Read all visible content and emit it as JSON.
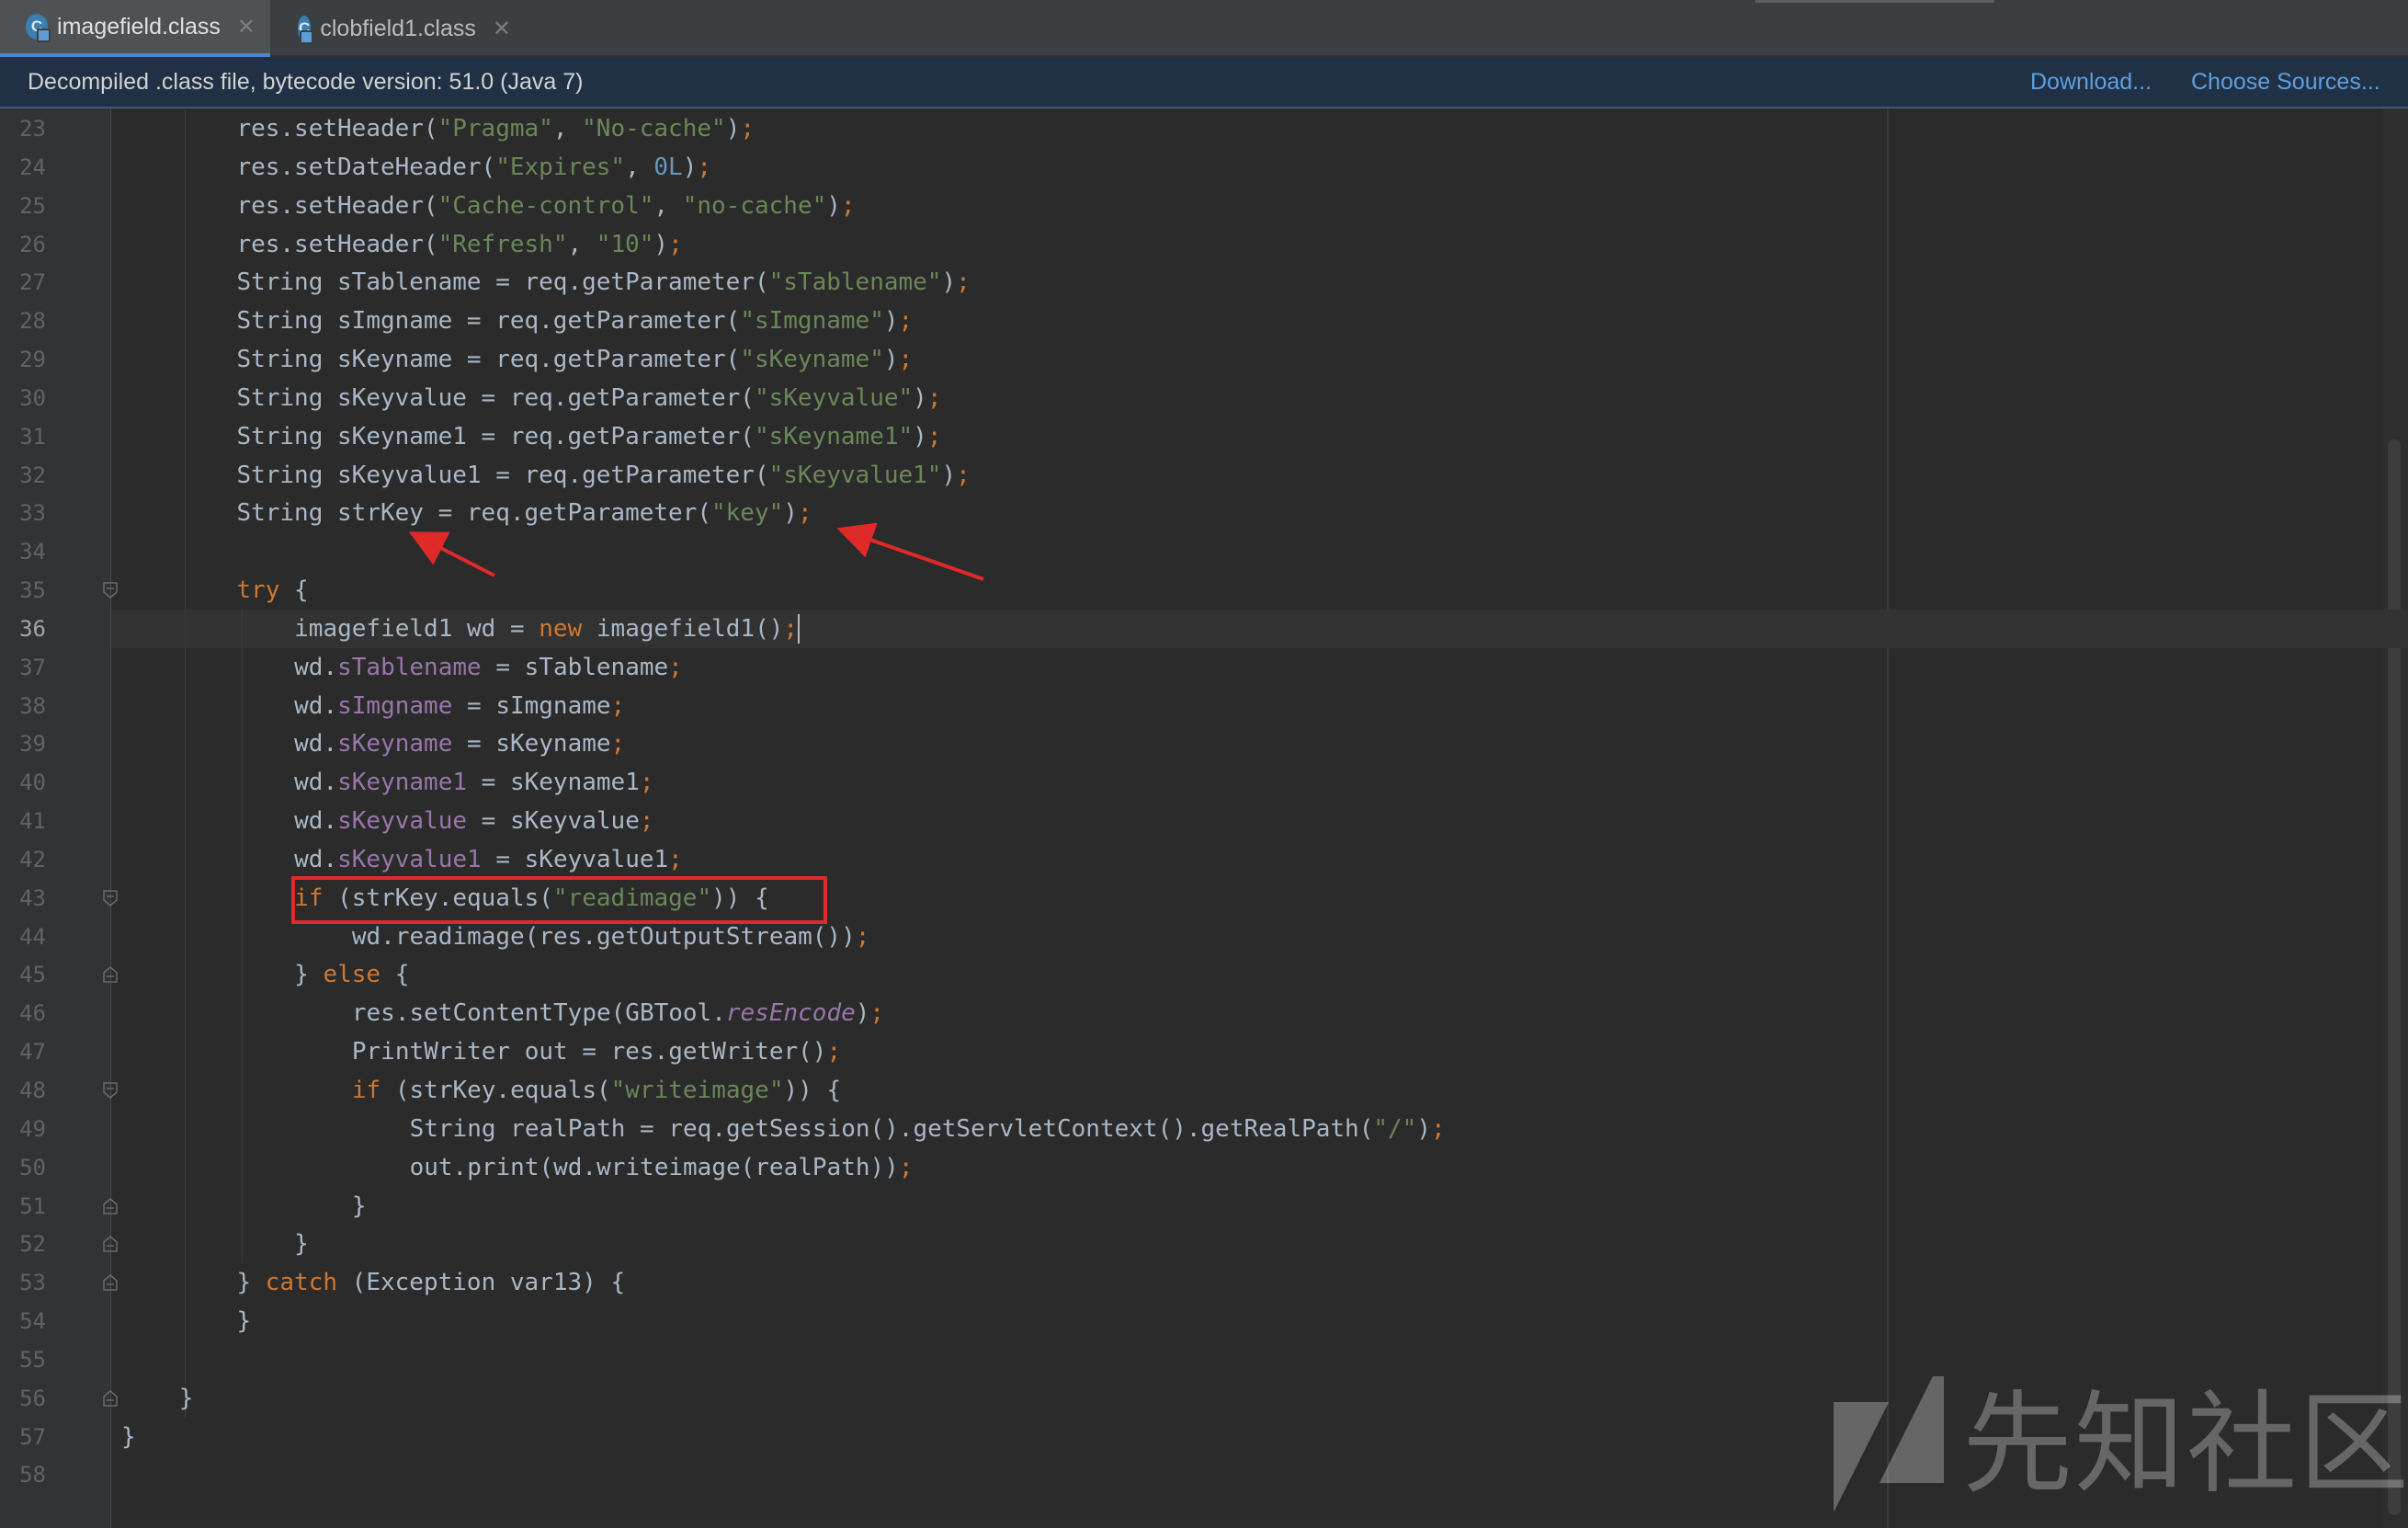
{
  "tabs": [
    {
      "label": "imagefield.class",
      "icon": "class-file-icon",
      "active": true
    },
    {
      "label": "clobfield1.class",
      "icon": "class-file-icon",
      "active": false
    }
  ],
  "banner": {
    "message": "Decompiled .class file, bytecode version: 51.0 (Java 7)",
    "download_label": "Download...",
    "choose_sources_label": "Choose Sources..."
  },
  "editor": {
    "current_line": 36,
    "line_numbers": [
      "23",
      "24",
      "25",
      "26",
      "27",
      "28",
      "29",
      "30",
      "31",
      "32",
      "33",
      "34",
      "35",
      "36",
      "37",
      "38",
      "39",
      "40",
      "41",
      "42",
      "43",
      "44",
      "45",
      "46",
      "47",
      "48",
      "49",
      "50",
      "51",
      "52",
      "53",
      "54",
      "55",
      "56",
      "57",
      "58"
    ]
  },
  "code_lines": [
    {
      "n": "23",
      "indent": 2,
      "tokens": [
        [
          "t",
          "res.setHeader("
        ],
        [
          "s",
          "\"Pragma\""
        ],
        [
          "t",
          ", "
        ],
        [
          "s",
          "\"No-cache\""
        ],
        [
          "t",
          ")"
        ],
        [
          "p",
          ";"
        ]
      ]
    },
    {
      "n": "24",
      "indent": 2,
      "tokens": [
        [
          "t",
          "res.setDateHeader("
        ],
        [
          "s",
          "\"Expires\""
        ],
        [
          "t",
          ", "
        ],
        [
          "n",
          "0L"
        ],
        [
          "t",
          ")"
        ],
        [
          "p",
          ";"
        ]
      ]
    },
    {
      "n": "25",
      "indent": 2,
      "tokens": [
        [
          "t",
          "res.setHeader("
        ],
        [
          "s",
          "\"Cache-control\""
        ],
        [
          "t",
          ", "
        ],
        [
          "s",
          "\"no-cache\""
        ],
        [
          "t",
          ")"
        ],
        [
          "p",
          ";"
        ]
      ]
    },
    {
      "n": "26",
      "indent": 2,
      "tokens": [
        [
          "t",
          "res.setHeader("
        ],
        [
          "s",
          "\"Refresh\""
        ],
        [
          "t",
          ", "
        ],
        [
          "s",
          "\"10\""
        ],
        [
          "t",
          ")"
        ],
        [
          "p",
          ";"
        ]
      ]
    },
    {
      "n": "27",
      "indent": 2,
      "tokens": [
        [
          "t",
          "String sTablename = req.getParameter("
        ],
        [
          "s",
          "\"sTablename\""
        ],
        [
          "t",
          ")"
        ],
        [
          "p",
          ";"
        ]
      ]
    },
    {
      "n": "28",
      "indent": 2,
      "tokens": [
        [
          "t",
          "String sImgname = req.getParameter("
        ],
        [
          "s",
          "\"sImgname\""
        ],
        [
          "t",
          ")"
        ],
        [
          "p",
          ";"
        ]
      ]
    },
    {
      "n": "29",
      "indent": 2,
      "tokens": [
        [
          "t",
          "String sKeyname = req.getParameter("
        ],
        [
          "s",
          "\"sKeyname\""
        ],
        [
          "t",
          ")"
        ],
        [
          "p",
          ";"
        ]
      ]
    },
    {
      "n": "30",
      "indent": 2,
      "tokens": [
        [
          "t",
          "String sKeyvalue = req.getParameter("
        ],
        [
          "s",
          "\"sKeyvalue\""
        ],
        [
          "t",
          ")"
        ],
        [
          "p",
          ";"
        ]
      ]
    },
    {
      "n": "31",
      "indent": 2,
      "tokens": [
        [
          "t",
          "String sKeyname1 = req.getParameter("
        ],
        [
          "s",
          "\"sKeyname1\""
        ],
        [
          "t",
          ")"
        ],
        [
          "p",
          ";"
        ]
      ]
    },
    {
      "n": "32",
      "indent": 2,
      "tokens": [
        [
          "t",
          "String sKeyvalue1 = req.getParameter("
        ],
        [
          "s",
          "\"sKeyvalue1\""
        ],
        [
          "t",
          ")"
        ],
        [
          "p",
          ";"
        ]
      ]
    },
    {
      "n": "33",
      "indent": 2,
      "tokens": [
        [
          "t",
          "String strKey = req.getParameter("
        ],
        [
          "s",
          "\"key\""
        ],
        [
          "t",
          ")"
        ],
        [
          "p",
          ";"
        ]
      ]
    },
    {
      "n": "34",
      "indent": 0,
      "tokens": []
    },
    {
      "n": "35",
      "indent": 2,
      "fold": "open",
      "tokens": [
        [
          "k",
          "try"
        ],
        [
          "t",
          " {"
        ]
      ]
    },
    {
      "n": "36",
      "indent": 3,
      "caret": true,
      "tokens": [
        [
          "t",
          "imagefield1 wd = "
        ],
        [
          "k",
          "new"
        ],
        [
          "t",
          " imagefield1()"
        ],
        [
          "p",
          ";"
        ]
      ]
    },
    {
      "n": "37",
      "indent": 3,
      "tokens": [
        [
          "t",
          "wd."
        ],
        [
          "f",
          "sTablename"
        ],
        [
          "t",
          " = sTablename"
        ],
        [
          "p",
          ";"
        ]
      ]
    },
    {
      "n": "38",
      "indent": 3,
      "tokens": [
        [
          "t",
          "wd."
        ],
        [
          "f",
          "sImgname"
        ],
        [
          "t",
          " = sImgname"
        ],
        [
          "p",
          ";"
        ]
      ]
    },
    {
      "n": "39",
      "indent": 3,
      "tokens": [
        [
          "t",
          "wd."
        ],
        [
          "f",
          "sKeyname"
        ],
        [
          "t",
          " = sKeyname"
        ],
        [
          "p",
          ";"
        ]
      ]
    },
    {
      "n": "40",
      "indent": 3,
      "tokens": [
        [
          "t",
          "wd."
        ],
        [
          "f",
          "sKeyname1"
        ],
        [
          "t",
          " = sKeyname1"
        ],
        [
          "p",
          ";"
        ]
      ]
    },
    {
      "n": "41",
      "indent": 3,
      "tokens": [
        [
          "t",
          "wd."
        ],
        [
          "f",
          "sKeyvalue"
        ],
        [
          "t",
          " = sKeyvalue"
        ],
        [
          "p",
          ";"
        ]
      ]
    },
    {
      "n": "42",
      "indent": 3,
      "tokens": [
        [
          "t",
          "wd."
        ],
        [
          "f",
          "sKeyvalue1"
        ],
        [
          "t",
          " = sKeyvalue1"
        ],
        [
          "p",
          ";"
        ]
      ]
    },
    {
      "n": "43",
      "indent": 3,
      "fold": "open",
      "tokens": [
        [
          "k",
          "if"
        ],
        [
          "t",
          " (strKey.equals("
        ],
        [
          "s",
          "\"readimage\""
        ],
        [
          "t",
          ")) {"
        ]
      ]
    },
    {
      "n": "44",
      "indent": 4,
      "tokens": [
        [
          "t",
          "wd.readimage(res.getOutputStream())"
        ],
        [
          "p",
          ";"
        ]
      ]
    },
    {
      "n": "45",
      "indent": 3,
      "fold": "close",
      "tokens": [
        [
          "t",
          "} "
        ],
        [
          "k",
          "else"
        ],
        [
          "t",
          " {"
        ]
      ]
    },
    {
      "n": "46",
      "indent": 4,
      "tokens": [
        [
          "t",
          "res.setContentType(GBTool."
        ],
        [
          "i",
          "resEncode"
        ],
        [
          "t",
          ")"
        ],
        [
          "p",
          ";"
        ]
      ]
    },
    {
      "n": "47",
      "indent": 4,
      "tokens": [
        [
          "t",
          "PrintWriter out = res.getWriter()"
        ],
        [
          "p",
          ";"
        ]
      ]
    },
    {
      "n": "48",
      "indent": 4,
      "fold": "open",
      "tokens": [
        [
          "k",
          "if"
        ],
        [
          "t",
          " (strKey.equals("
        ],
        [
          "s",
          "\"writeimage\""
        ],
        [
          "t",
          ")) {"
        ]
      ]
    },
    {
      "n": "49",
      "indent": 5,
      "tokens": [
        [
          "t",
          "String realPath = req.getSession().getServletContext().getRealPath("
        ],
        [
          "s",
          "\"/\""
        ],
        [
          "t",
          ")"
        ],
        [
          "p",
          ";"
        ]
      ]
    },
    {
      "n": "50",
      "indent": 5,
      "tokens": [
        [
          "t",
          "out.print(wd.writeimage(realPath))"
        ],
        [
          "p",
          ";"
        ]
      ]
    },
    {
      "n": "51",
      "indent": 4,
      "fold": "close",
      "tokens": [
        [
          "t",
          "}"
        ]
      ]
    },
    {
      "n": "52",
      "indent": 3,
      "fold": "close",
      "tokens": [
        [
          "t",
          "}"
        ]
      ]
    },
    {
      "n": "53",
      "indent": 2,
      "fold": "close",
      "tokens": [
        [
          "t",
          "} "
        ],
        [
          "k",
          "catch"
        ],
        [
          "t",
          " (Exception var13) {"
        ]
      ]
    },
    {
      "n": "54",
      "indent": 2,
      "tokens": [
        [
          "t",
          "}"
        ]
      ]
    },
    {
      "n": "55",
      "indent": 0,
      "tokens": []
    },
    {
      "n": "56",
      "indent": 1,
      "fold": "close",
      "tokens": [
        [
          "t",
          "}"
        ]
      ]
    },
    {
      "n": "57",
      "indent": 0,
      "tokens": [
        [
          "t",
          "}"
        ]
      ]
    },
    {
      "n": "58",
      "indent": 0,
      "tokens": []
    }
  ],
  "watermark": {
    "text": "先知社区"
  },
  "colors": {
    "background": "#2b2b2b",
    "gutter": "#313335",
    "keyword": "#cc7832",
    "string": "#6a8759",
    "number": "#6897bb",
    "field": "#9876aa",
    "plain": "#a9b7c6",
    "annotation_red": "#e02929",
    "link": "#5e9fe0"
  }
}
